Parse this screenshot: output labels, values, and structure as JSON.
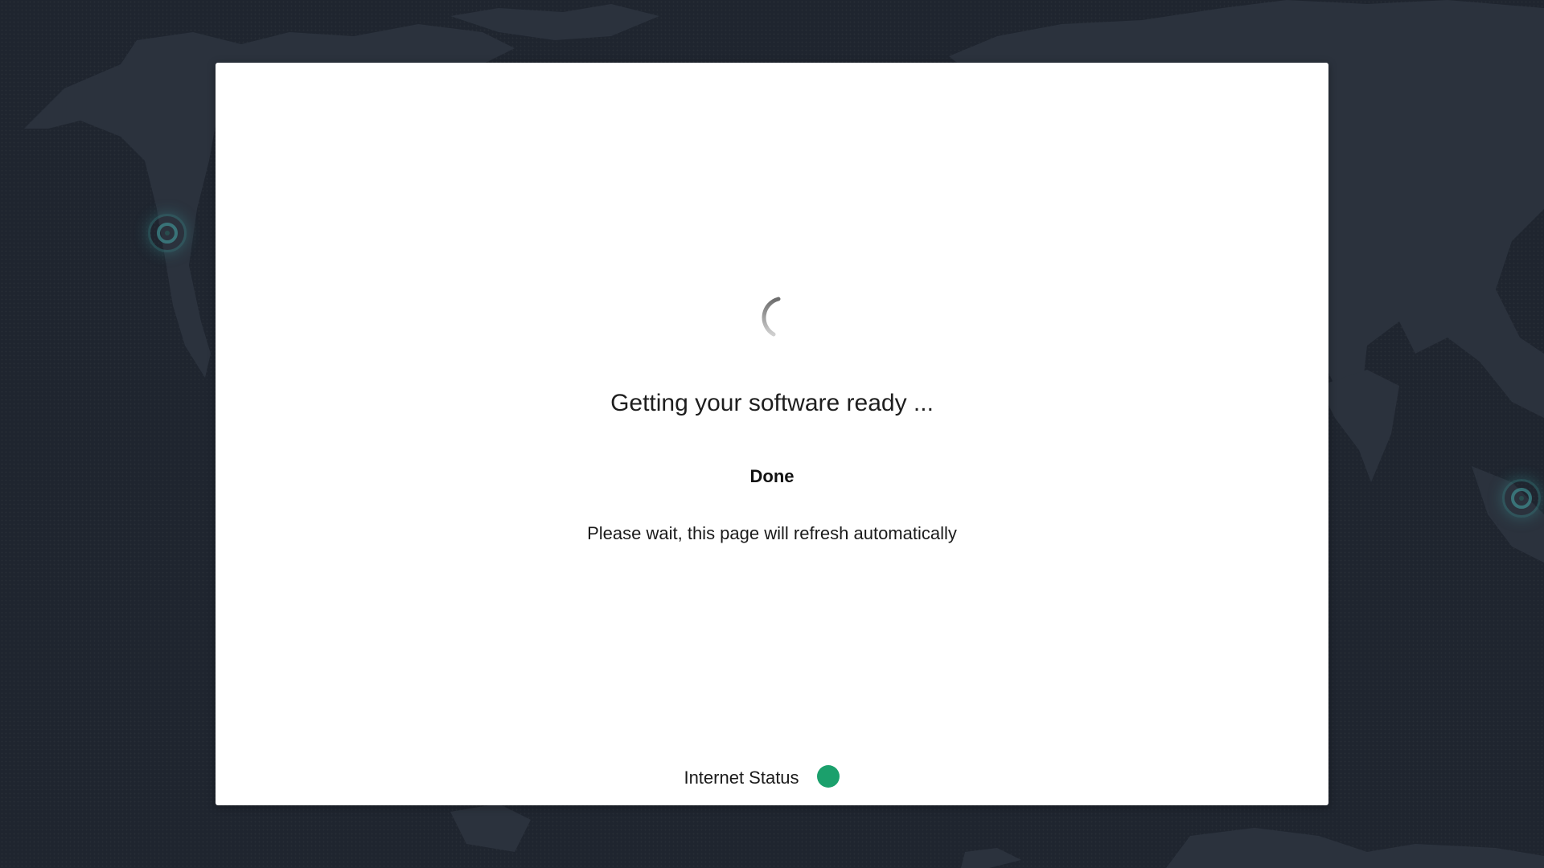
{
  "loader": {
    "title": "Getting your software ready ...",
    "status": "Done",
    "message": "Please wait, this page will refresh automatically",
    "spinner_icon": "loading-spinner-icon"
  },
  "internet_status": {
    "label": "Internet Status",
    "state_color": "#1ba06c"
  },
  "colors": {
    "background": "#1f252f",
    "landmass": "#2b323d",
    "card": "#ffffff",
    "marker": "#3a9696"
  }
}
